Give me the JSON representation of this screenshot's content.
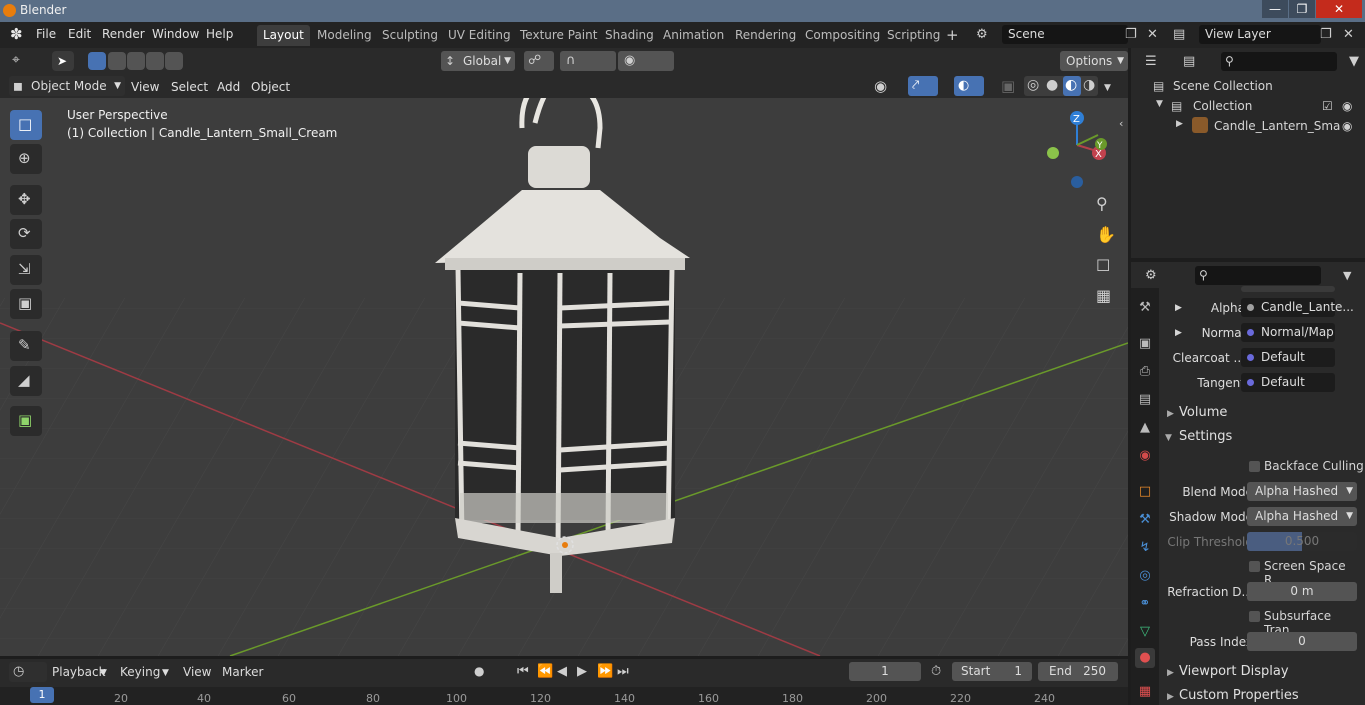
{
  "window": {
    "title": "Blender"
  },
  "menubar": {
    "items": [
      "File",
      "Edit",
      "Render",
      "Window",
      "Help"
    ]
  },
  "workspaces": [
    "Layout",
    "Modeling",
    "Sculpting",
    "UV Editing",
    "Texture Paint",
    "Shading",
    "Animation",
    "Rendering",
    "Compositing",
    "Scripting"
  ],
  "scene": {
    "name": "Scene",
    "view_layer": "View Layer"
  },
  "viewport_header": {
    "mode": "Object Mode",
    "menus": [
      "View",
      "Select",
      "Add",
      "Object"
    ],
    "orientation": "Global",
    "options": "Options"
  },
  "viewport": {
    "perspective": "User Perspective",
    "collection_info": "(1) Collection | Candle_Lantern_Small_Cream",
    "axes": {
      "x": "X",
      "y": "Y",
      "z": "Z"
    }
  },
  "outliner": {
    "scene_collection": "Scene Collection",
    "collection": "Collection",
    "object": "Candle_Lantern_Sma"
  },
  "properties": {
    "rows": [
      {
        "label": "Alpha",
        "value": "Candle_Lante..."
      },
      {
        "label": "Normal",
        "value": "Normal/Map"
      },
      {
        "label": "Clearcoat ...",
        "value": "Default"
      },
      {
        "label": "Tangent",
        "value": "Default"
      }
    ],
    "sections": {
      "volume": "Volume",
      "settings": "Settings",
      "viewport_display": "Viewport Display",
      "custom_properties": "Custom Properties"
    },
    "settings": {
      "backface_culling": "Backface Culling",
      "blend_mode_label": "Blend Mode",
      "blend_mode": "Alpha Hashed",
      "shadow_mode_label": "Shadow Mode",
      "shadow_mode": "Alpha Hashed",
      "clip_threshold_label": "Clip Threshold",
      "clip_threshold": "0.500",
      "screen_space": "Screen Space R...",
      "refraction_label": "Refraction D...",
      "refraction": "0 m",
      "subsurface": "Subsurface Tran...",
      "pass_index_label": "Pass Index",
      "pass_index": "0"
    }
  },
  "timeline": {
    "menus": [
      "Playback",
      "Keying",
      "View",
      "Marker"
    ],
    "current_frame": "1",
    "start_label": "Start",
    "start": "1",
    "end_label": "End",
    "end": "250",
    "ruler": [
      "20",
      "40",
      "60",
      "80",
      "100",
      "120",
      "140",
      "160",
      "180",
      "200",
      "220",
      "240"
    ],
    "ruler_current": "1"
  },
  "colors": {
    "accent": "#4772b3",
    "x_axis": "#b3404a",
    "y_axis": "#6a9a2a",
    "z_axis": "#2f7fd6"
  }
}
